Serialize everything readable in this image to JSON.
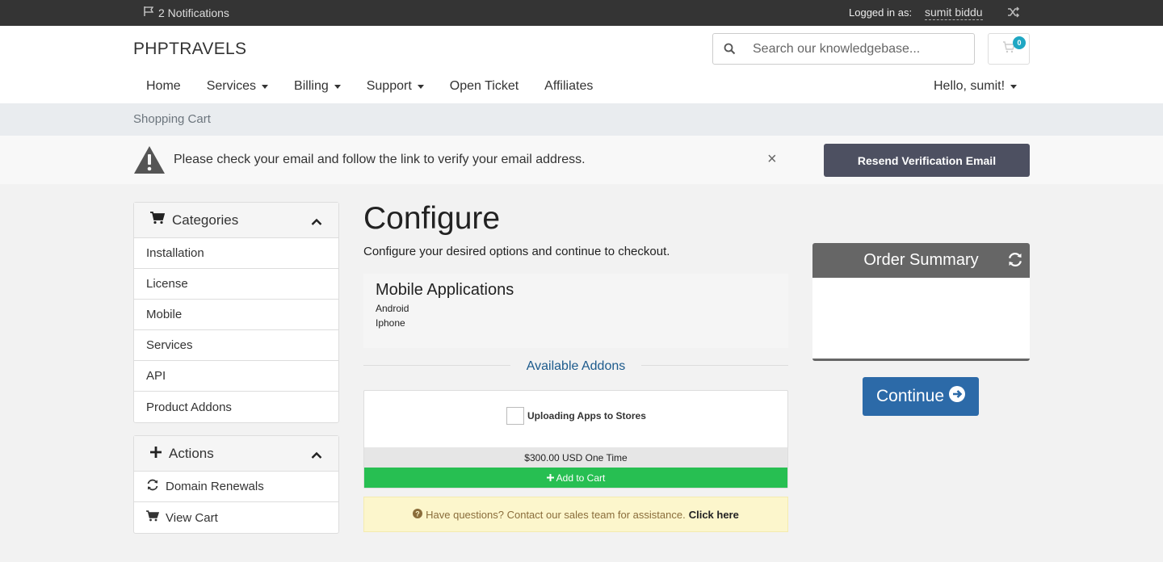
{
  "topbar": {
    "notifications": "2 Notifications",
    "logged_in_label": "Logged in as:",
    "username": "sumit biddu"
  },
  "header": {
    "brand": "PHPTRAVELS",
    "search_placeholder": "Search our knowledgebase...",
    "cart_count": "0"
  },
  "nav": {
    "items": [
      {
        "label": "Home",
        "dropdown": false
      },
      {
        "label": "Services",
        "dropdown": true
      },
      {
        "label": "Billing",
        "dropdown": true
      },
      {
        "label": "Support",
        "dropdown": true
      },
      {
        "label": "Open Ticket",
        "dropdown": false
      },
      {
        "label": "Affiliates",
        "dropdown": false
      }
    ],
    "greeting": "Hello, sumit!"
  },
  "breadcrumb": "Shopping Cart",
  "verify": {
    "message": "Please check your email and follow the link to verify your email address.",
    "close": "×",
    "button": "Resend Verification Email"
  },
  "sidebar": {
    "categories_title": "Categories",
    "categories": [
      "Installation",
      "License",
      "Mobile",
      "Services",
      "API",
      "Product Addons"
    ],
    "actions_title": "Actions",
    "actions": [
      "Domain Renewals",
      "View Cart"
    ]
  },
  "main": {
    "title": "Configure",
    "subtitle": "Configure your desired options and continue to checkout.",
    "product": {
      "name": "Mobile Applications",
      "features": [
        "Android",
        "Iphone"
      ]
    },
    "addons_heading": "Available Addons",
    "addon": {
      "name": "Uploading Apps to Stores",
      "price": "$300.00 USD One Time",
      "add_label": "Add to Cart"
    },
    "sales": {
      "text": "Have questions? Contact our sales team for assistance.",
      "link": "Click here"
    }
  },
  "summary": {
    "title": "Order Summary",
    "continue_label": "Continue"
  },
  "colors": {
    "topbar": "#343434",
    "resend_button": "#4d5061",
    "add_to_cart": "#27bf52",
    "continue_button": "#2c6aa8",
    "summary_header": "#666666",
    "cart_badge": "#1fa7c3"
  }
}
